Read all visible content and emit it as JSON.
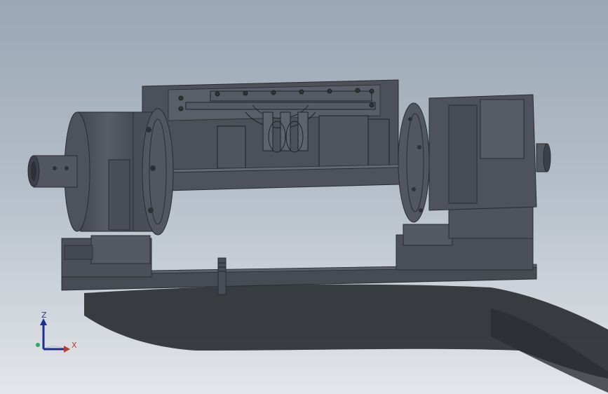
{
  "viewport": {
    "background_top": "#9aa6b4",
    "background_bottom": "#e3e6ea",
    "model_color": "#4a4e58",
    "shadow_color": "#2c2f35"
  },
  "triad": {
    "z_label": "Z",
    "x_label": "X",
    "z_color": "#1f2f8f",
    "x_color": "#c0392b",
    "y_color": "#27ae60"
  }
}
